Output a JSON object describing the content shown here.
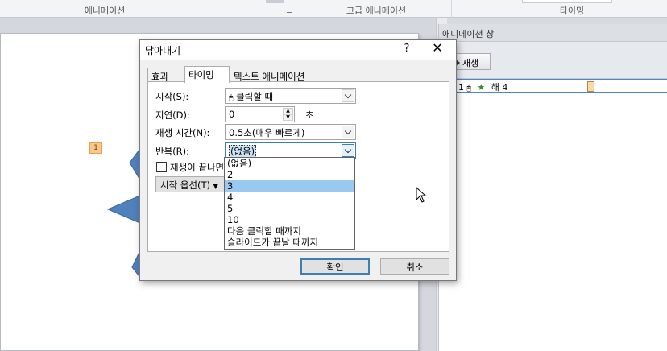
{
  "ribbon": {
    "group_animation": "애니메이션",
    "group_advanced": "고급 애니메이션",
    "group_timing": "타이밍"
  },
  "animation_pane": {
    "title": "애니메이션 창",
    "play_button": "재생",
    "item": {
      "index": "1",
      "name": "해 4"
    }
  },
  "slide": {
    "anim_tag": "1"
  },
  "dialog": {
    "title": "닦아내기",
    "help": "?",
    "close": "✕",
    "tabs": [
      {
        "label": "효과",
        "active": false
      },
      {
        "label": "타이밍",
        "active": true
      },
      {
        "label": "텍스트 애니메이션",
        "active": false
      }
    ],
    "fields": {
      "start_label": "시작(S):",
      "start_value": "클릭할 때",
      "delay_label": "지연(D):",
      "delay_value": "0",
      "delay_unit": "초",
      "duration_label": "재생 시간(N):",
      "duration_value": "0.5초(매우 빠르게)",
      "repeat_label": "반복(R):",
      "repeat_value": "(없음)",
      "rewind_label": "재생이 끝나면",
      "triggers_label": "시작 옵션(T)"
    },
    "repeat_options": [
      "(없음)",
      "2",
      "3",
      "4",
      "5",
      "10",
      "다음 클릭할 때까지",
      "슬라이드가 끝날 때까지"
    ],
    "repeat_highlighted": "3",
    "ok_button": "확인",
    "cancel_button": "취소"
  }
}
